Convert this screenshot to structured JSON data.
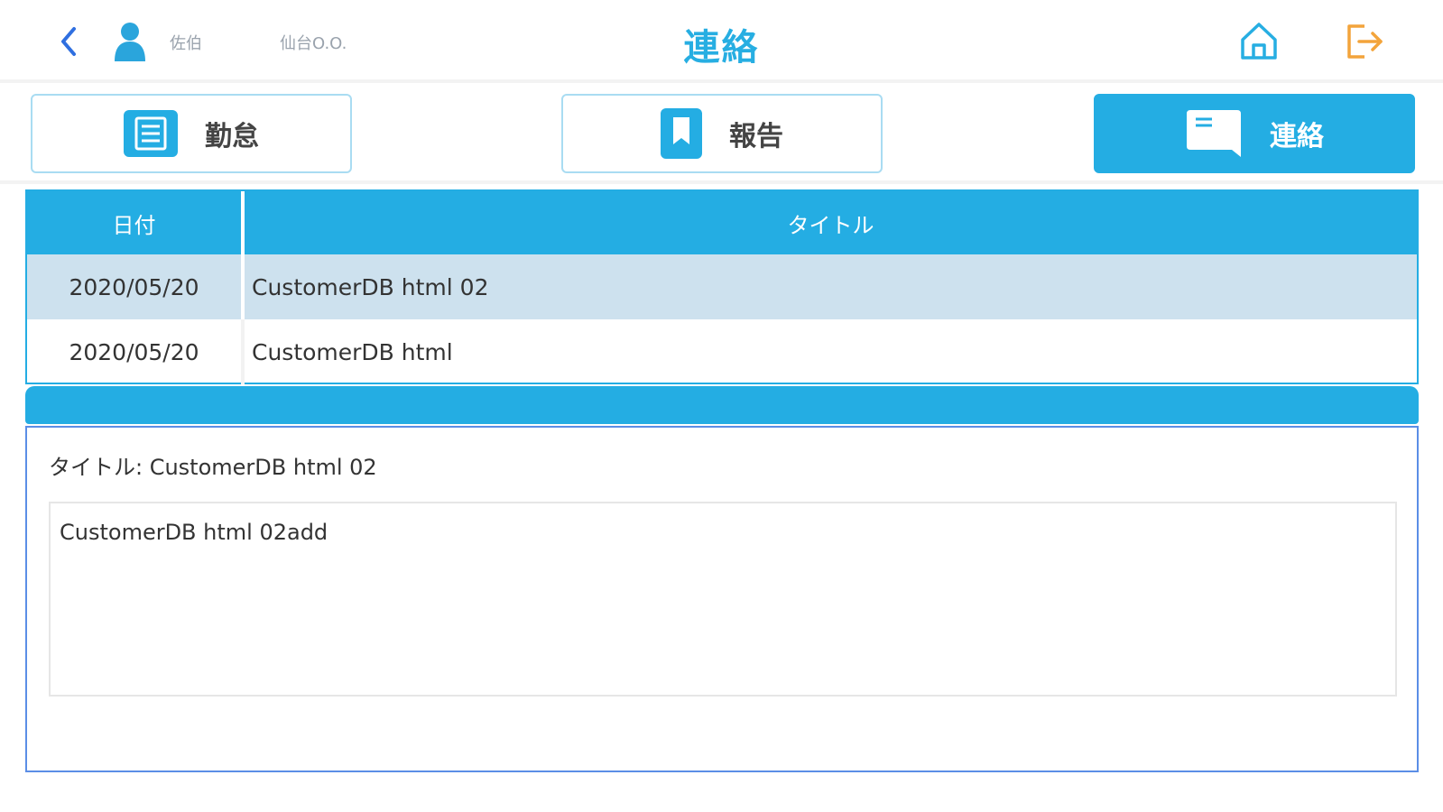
{
  "header": {
    "title": "連絡",
    "user_name": "佐伯",
    "user_org": "仙台O.O."
  },
  "tabs": [
    {
      "label": "勤怠",
      "icon": "list-icon",
      "active": false
    },
    {
      "label": "報告",
      "icon": "bookmark-icon",
      "active": false
    },
    {
      "label": "連絡",
      "icon": "message-icon",
      "active": true
    }
  ],
  "table": {
    "headers": {
      "date": "日付",
      "title": "タイトル"
    },
    "rows": [
      {
        "date": "2020/05/20",
        "title": "CustomerDB html 02",
        "selected": true
      },
      {
        "date": "2020/05/20",
        "title": "CustomerDB html",
        "selected": false
      }
    ]
  },
  "detail": {
    "title": "タイトル: CustomerDB html 02",
    "body": "CustomerDB html 02add"
  },
  "colors": {
    "accent": "#24ade3",
    "selected_row": "#cde1ee",
    "logout": "#f3a43b",
    "detail_border": "#5b8ee6"
  }
}
